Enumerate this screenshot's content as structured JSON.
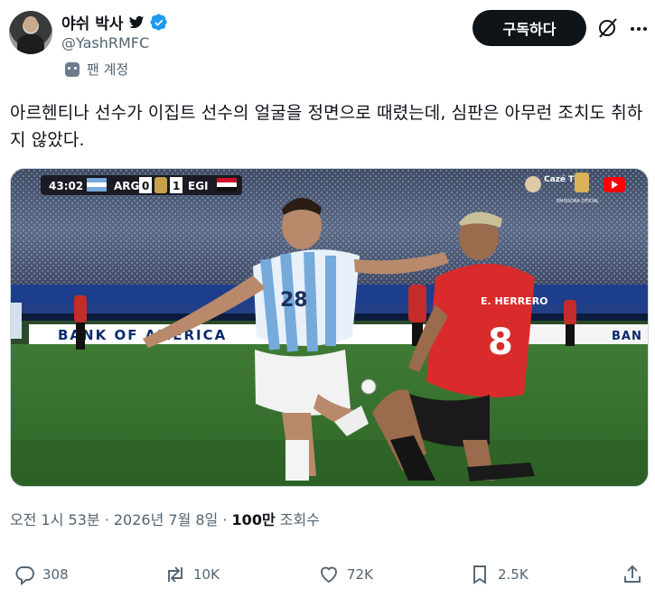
{
  "user": {
    "name": "야쉬 박사",
    "handle": "@YashRMFC",
    "fan_label": "팬 계정"
  },
  "header": {
    "subscribe_label": "구독하다"
  },
  "tweet": {
    "text": "아르헨티나 선수가 이집트 선수의 얼굴을 정면으로 때렸는데, 심판은 아무런 조치도 취하지 않았다."
  },
  "media": {
    "scoreboard": {
      "time": "43:02",
      "home": "ARG",
      "home_score": "0",
      "away_score": "1",
      "away": "EGI"
    },
    "broadcaster": "Cazé TV",
    "broadcaster_sub": "EMISSORA OFICIAL",
    "ad_board": "BANK OF AMERICA",
    "ad_board_right": "BAN",
    "player_left_number": "28",
    "player_right_name": "E. HERRERO",
    "player_right_number": "8"
  },
  "meta": {
    "time": "오전 1시 53분",
    "date": "2026년 7월 8일",
    "views_count": "100만",
    "views_label": "조회수"
  },
  "actions": {
    "replies": "308",
    "reposts": "10K",
    "likes": "72K",
    "bookmarks": "2.5K"
  },
  "colors": {
    "verified": "#1d9bf0",
    "subscribe_bg": "#0f1419",
    "muted": "#536471"
  }
}
